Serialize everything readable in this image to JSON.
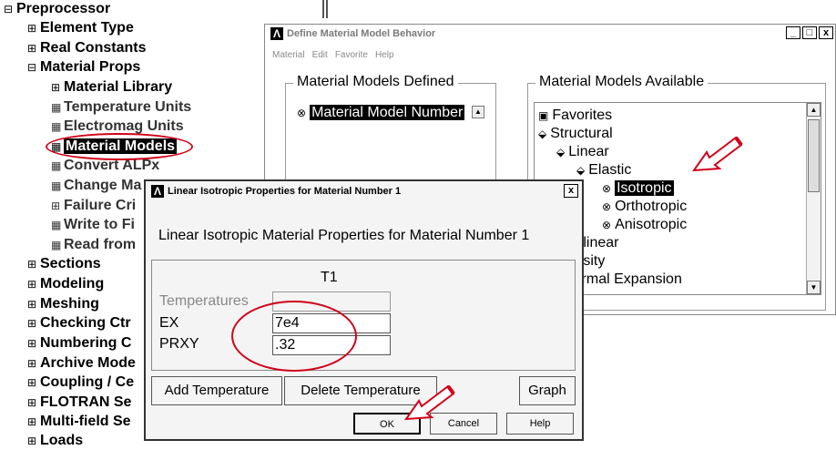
{
  "tree": {
    "items": [
      {
        "glyph": "⊟",
        "label": "Preprocessor"
      },
      {
        "glyph": "⊞",
        "label": "Element Type"
      },
      {
        "glyph": "⊞",
        "label": "Real Constants"
      },
      {
        "glyph": "⊟",
        "label": "Material Props"
      },
      {
        "glyph": "⊞",
        "label": "Material Library"
      },
      {
        "glyph": "▦",
        "label": "Temperature Units"
      },
      {
        "glyph": "▦",
        "label": "Electromag Units"
      },
      {
        "glyph": "▦",
        "label": "Material Models"
      },
      {
        "glyph": "▦",
        "label": "Convert ALPx"
      },
      {
        "glyph": "▦",
        "label": "Change Ma"
      },
      {
        "glyph": "⊞",
        "label": "Failure Cri"
      },
      {
        "glyph": "▦",
        "label": "Write to Fi"
      },
      {
        "glyph": "▦",
        "label": "Read from"
      },
      {
        "glyph": "⊞",
        "label": "Sections"
      },
      {
        "glyph": "⊞",
        "label": "Modeling"
      },
      {
        "glyph": "⊞",
        "label": "Meshing"
      },
      {
        "glyph": "⊞",
        "label": "Checking Ctr"
      },
      {
        "glyph": "⊞",
        "label": "Numbering C"
      },
      {
        "glyph": "⊞",
        "label": "Archive Mode"
      },
      {
        "glyph": "⊞",
        "label": "Coupling / Ce"
      },
      {
        "glyph": "⊞",
        "label": "FLOTRAN Se"
      },
      {
        "glyph": "⊞",
        "label": "Multi-field Se"
      },
      {
        "glyph": "⊞",
        "label": "Loads"
      }
    ]
  },
  "main_window": {
    "title": "Define Material Model Behavior",
    "buttons": [
      "_",
      "□",
      "x"
    ],
    "menu": [
      "Material",
      "Edit",
      "Favorite",
      "Help"
    ],
    "defined": {
      "title": "Material Models Defined",
      "items": [
        {
          "icon": "⊗",
          "label": "Material Model Number"
        }
      ]
    },
    "available": {
      "title": "Material Models Available",
      "items": [
        {
          "icon": "▣",
          "label": "Favorites"
        },
        {
          "icon": "⬙",
          "label": "Structural"
        },
        {
          "icon": "⬙",
          "label": "Linear"
        },
        {
          "icon": "⬙",
          "label": "Elastic"
        },
        {
          "icon": "⊗",
          "label": "Isotropic"
        },
        {
          "icon": "⊗",
          "label": "Orthotropic"
        },
        {
          "icon": "⊗",
          "label": "Anisotropic"
        },
        {
          "icon": "",
          "label": "Nonlinear"
        },
        {
          "icon": "",
          "label": "Density"
        },
        {
          "icon": "",
          "label": "Thermal Expansion"
        }
      ]
    }
  },
  "dialog": {
    "title": "Linear Isotropic Properties for Material Number 1",
    "close": "x",
    "heading": "Linear Isotropic Material Properties for Material Number 1",
    "column": "T1",
    "rows": [
      {
        "label": "Temperatures",
        "value": ""
      },
      {
        "label": "EX",
        "value": "7e4"
      },
      {
        "label": "PRXY",
        "value": ".32"
      }
    ],
    "add_temperature": "Add Temperature",
    "delete_temperature": "Delete Temperature",
    "graph": "Graph",
    "ok": "OK",
    "cancel": "Cancel",
    "help": "Help"
  },
  "colors": {
    "annotation": "#d0021b",
    "selection": "#000000"
  }
}
